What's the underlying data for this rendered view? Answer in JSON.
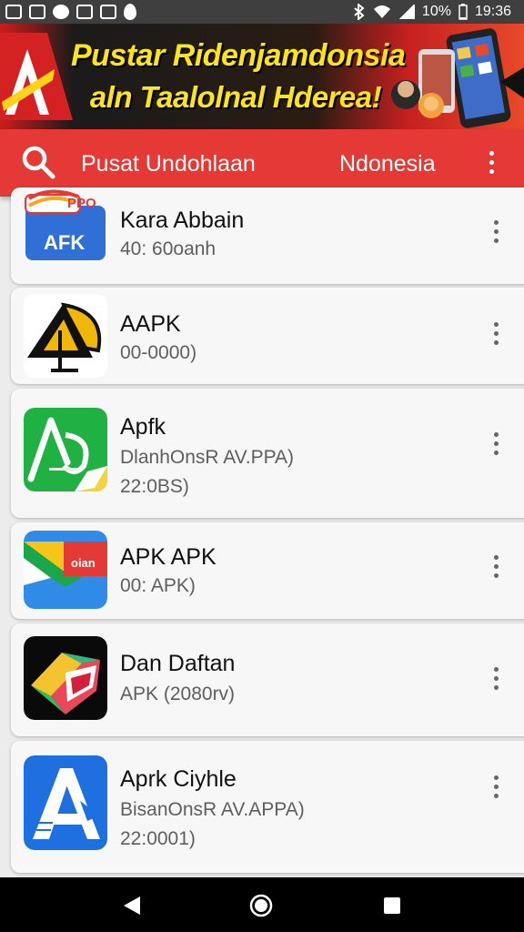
{
  "status_bar": {
    "battery": "10%",
    "time": "19:36"
  },
  "banner": {
    "line1": "Pustar Ridenjamdonsia",
    "line2": "aln Taalolnal Hderea!"
  },
  "app_bar": {
    "title": "Pusat Undohlaan",
    "region": "Ndonesia"
  },
  "apps": [
    {
      "name": "Kara Abbain",
      "lines": [
        "40: 60oanh"
      ],
      "icon": "apk-folder-icon"
    },
    {
      "name": "AAPK",
      "lines": [
        "00-0000)"
      ],
      "icon": "aapk-triangle-icon"
    },
    {
      "name": "Apfk",
      "lines": [
        "DlanhOnsR AV.PPA)",
        "22:0BS)"
      ],
      "icon": "apfk-green-icon"
    },
    {
      "name": "APK APK",
      "lines": [
        "00: APK)"
      ],
      "icon": "apk-envelope-icon"
    },
    {
      "name": "Dan Daftan",
      "lines": [
        "APK (2080rv)"
      ],
      "icon": "dan-daftan-cube-icon"
    },
    {
      "name": "Aprk Ciyhle",
      "lines": [
        "BisanOnsR AV.APPA)",
        "22:0001)"
      ],
      "icon": "aprk-blue-icon"
    }
  ],
  "icon_labels": {
    "folder_top": "PPO",
    "folder_main": "AFK",
    "envelope_tag": "oian"
  },
  "colors": {
    "accent": "#e53935",
    "banner_text": "#ffe419",
    "nav_bar": "#000000"
  }
}
